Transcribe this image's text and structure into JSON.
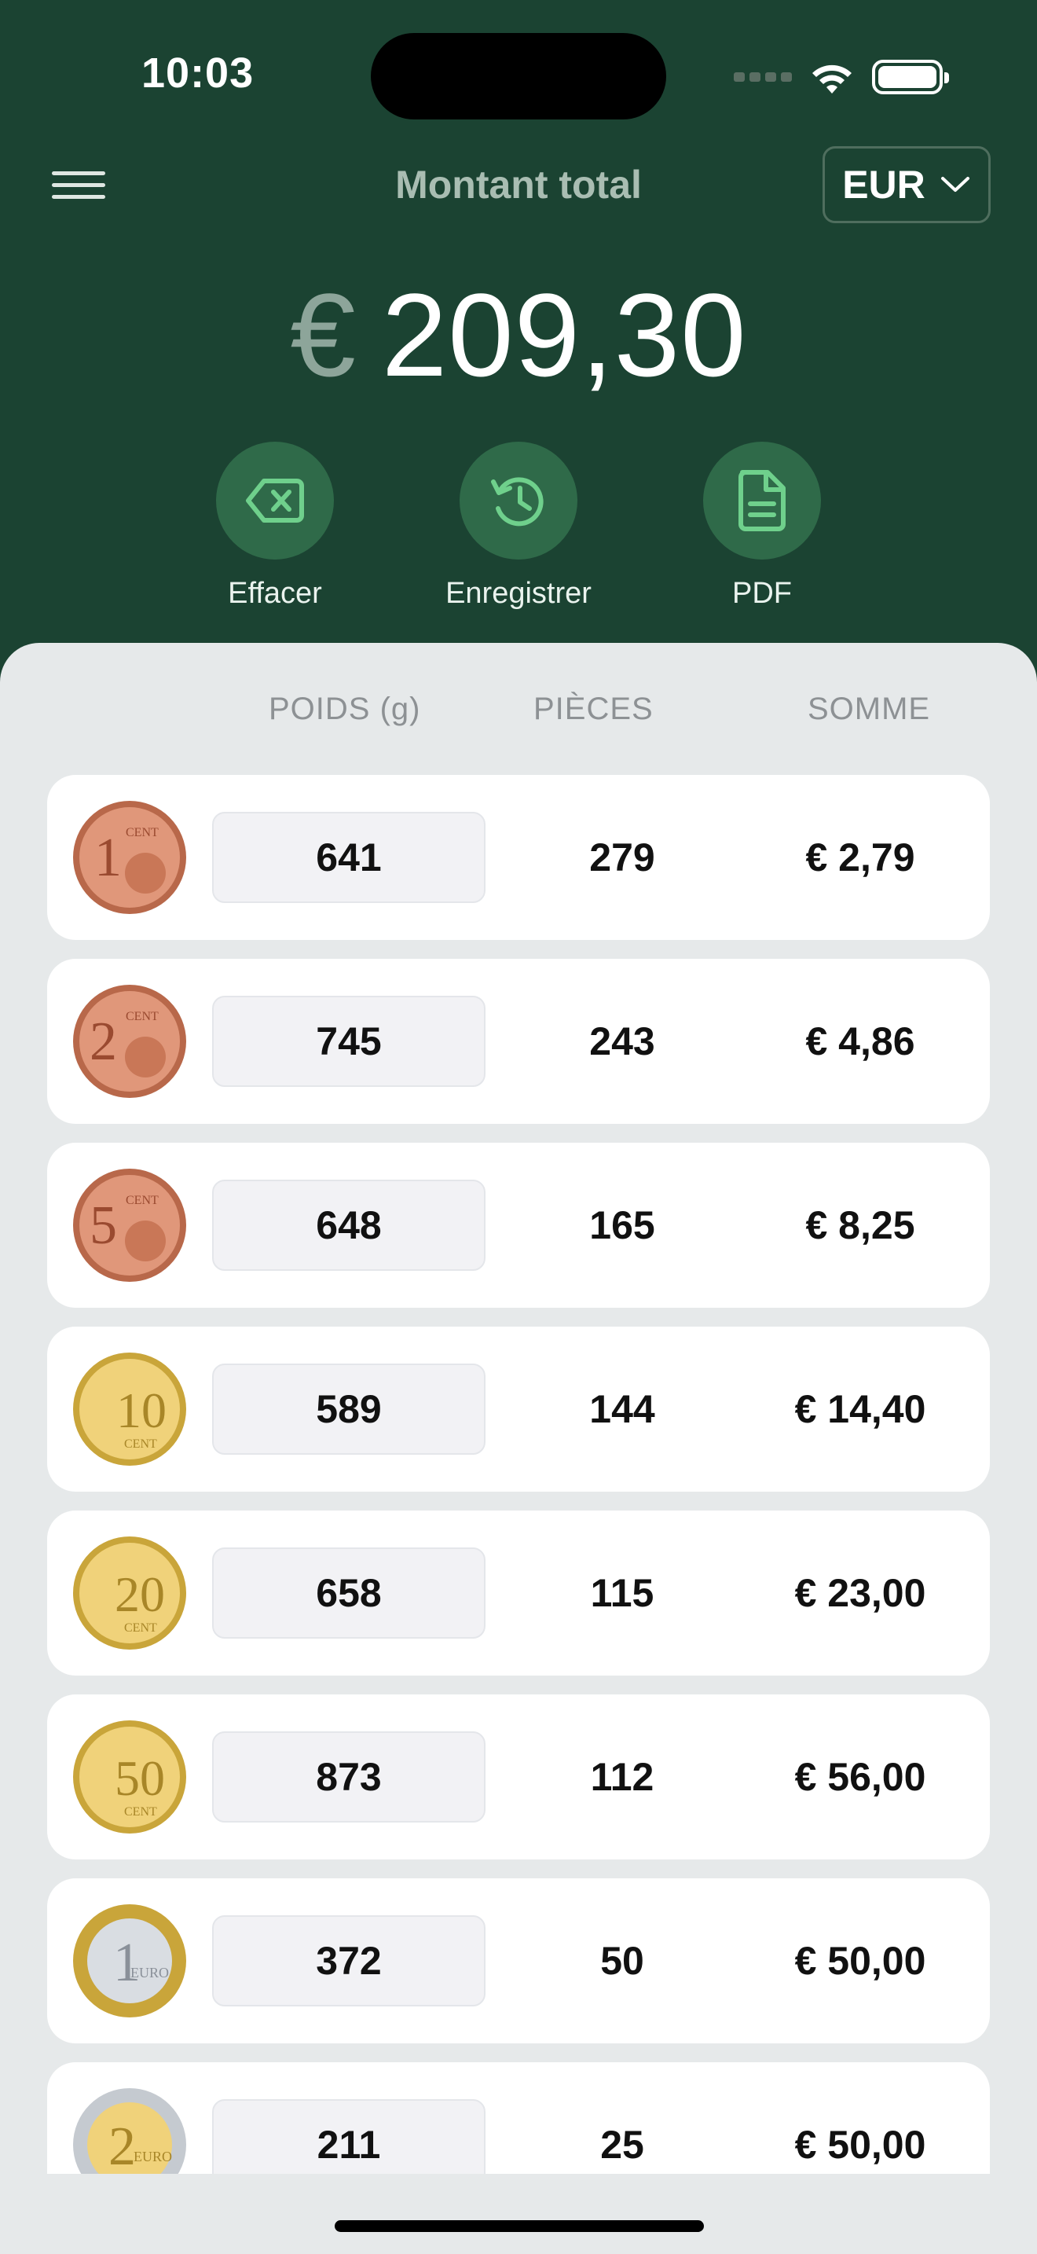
{
  "status_bar": {
    "time": "10:03"
  },
  "header": {
    "title": "Montant total",
    "currency": "EUR",
    "total_symbol": "€",
    "total_value": "209,30"
  },
  "actions": [
    {
      "label": "Effacer",
      "icon": "backspace-icon"
    },
    {
      "label": "Enregistrer",
      "icon": "history-icon"
    },
    {
      "label": "PDF",
      "icon": "document-icon"
    }
  ],
  "columns": {
    "weight": "POIDS (g)",
    "pieces": "PIÈCES",
    "sum": "SOMME"
  },
  "rows": [
    {
      "coin": "1 cent",
      "weight": "641",
      "pieces": "279",
      "sum": "€ 2,79"
    },
    {
      "coin": "2 cent",
      "weight": "745",
      "pieces": "243",
      "sum": "€ 4,86"
    },
    {
      "coin": "5 cent",
      "weight": "648",
      "pieces": "165",
      "sum": "€ 8,25"
    },
    {
      "coin": "10 cent",
      "weight": "589",
      "pieces": "144",
      "sum": "€ 14,40"
    },
    {
      "coin": "20 cent",
      "weight": "658",
      "pieces": "115",
      "sum": "€ 23,00"
    },
    {
      "coin": "50 cent",
      "weight": "873",
      "pieces": "112",
      "sum": "€ 56,00"
    },
    {
      "coin": "1 euro",
      "weight": "372",
      "pieces": "50",
      "sum": "€ 50,00"
    },
    {
      "coin": "2 euro",
      "weight": "211",
      "pieces": "25",
      "sum": "€ 50,00"
    }
  ],
  "colors": {
    "header_bg": "#1b4332",
    "action_circle": "#2f6a49",
    "action_icon": "#6fd08c",
    "panel_bg": "#e6e9ea"
  }
}
